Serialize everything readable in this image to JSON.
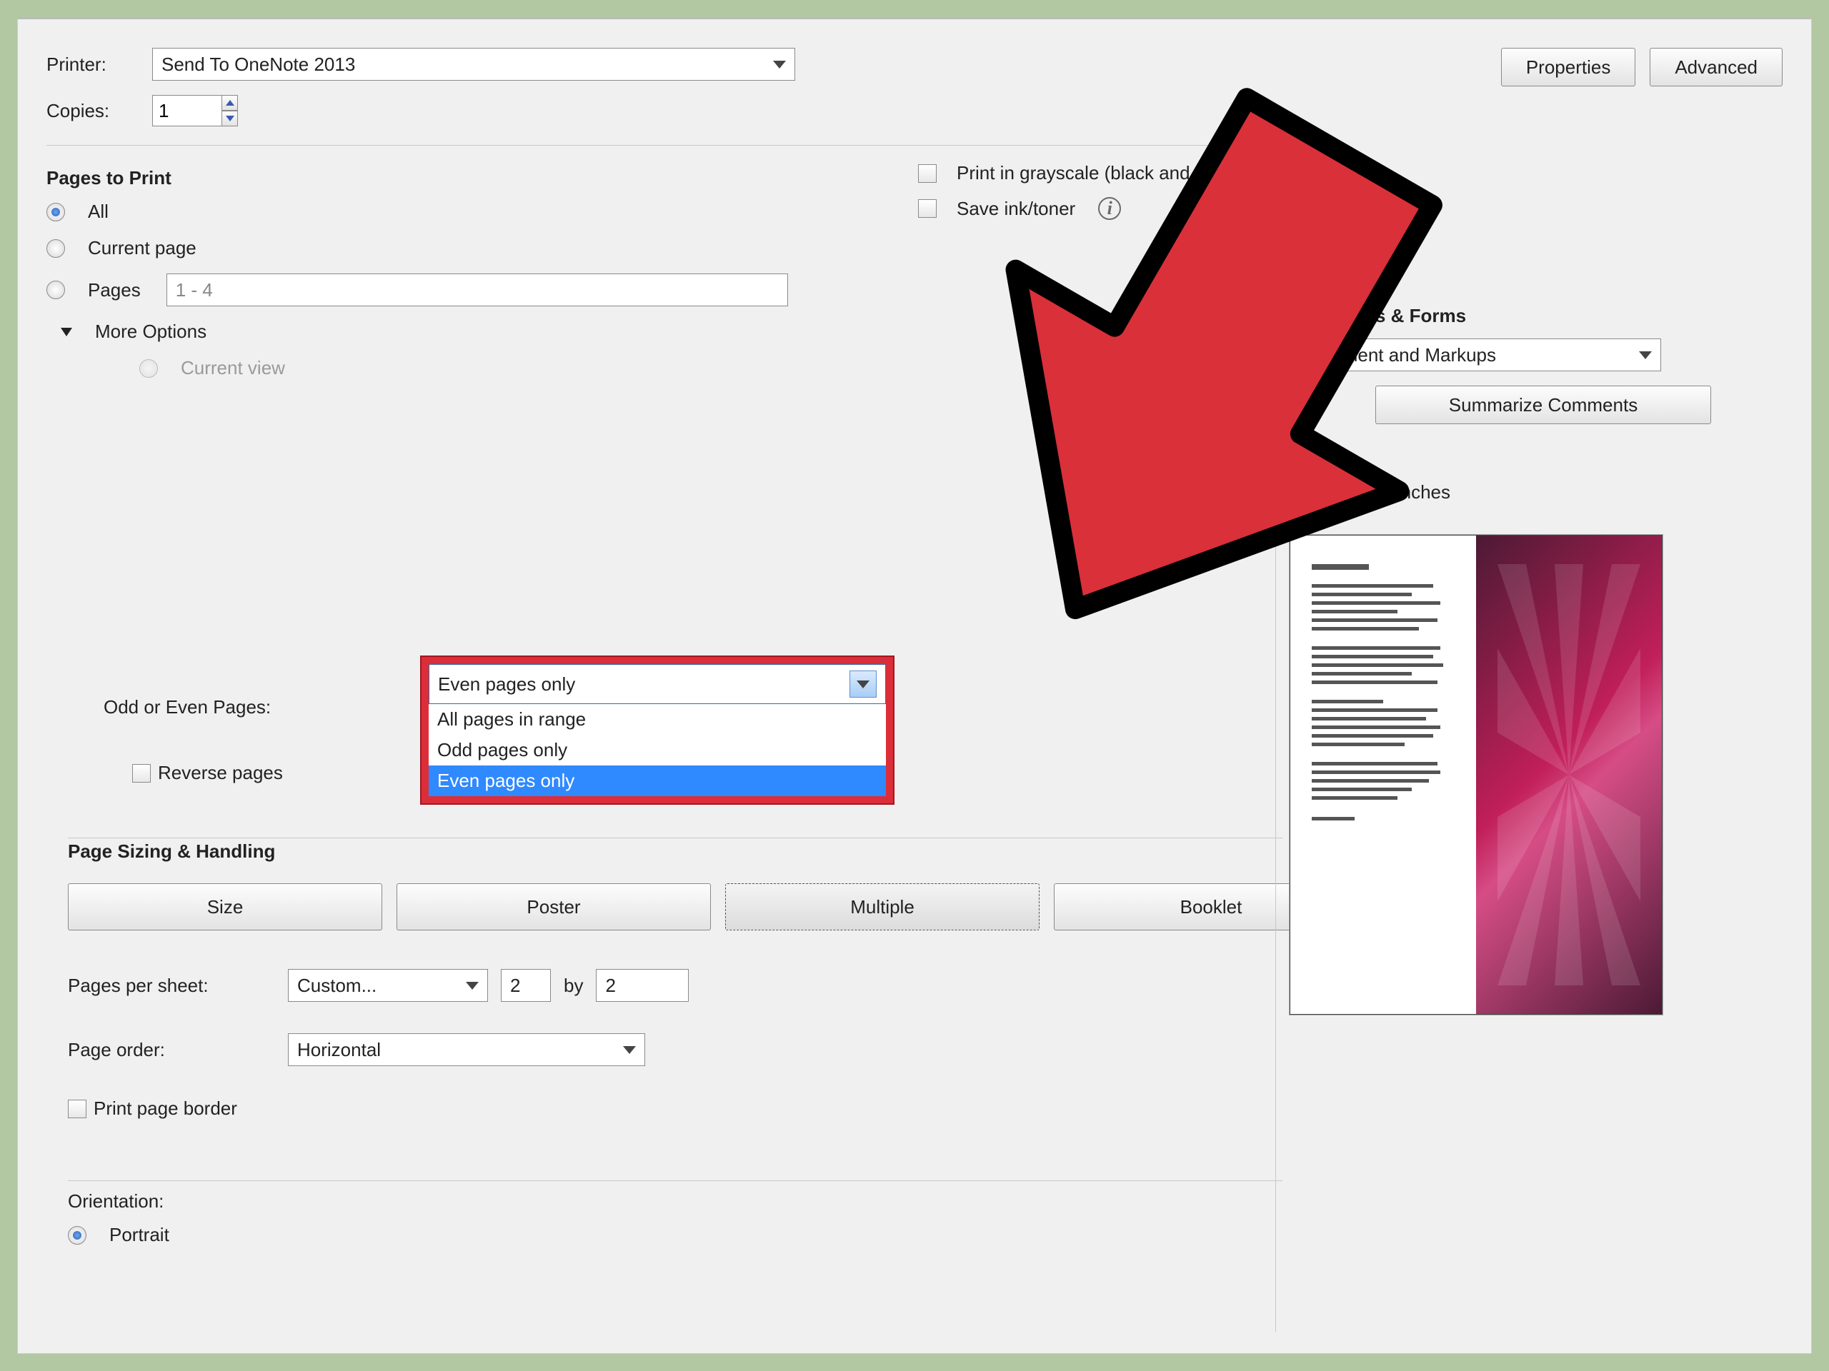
{
  "top": {
    "printer_label": "Printer:",
    "printer_value": "Send To OneNote 2013",
    "copies_label": "Copies:",
    "copies_value": "1",
    "properties_btn": "Properties",
    "advanced_btn": "Advanced",
    "grayscale_label": "Print in grayscale (black and white)",
    "saveink_label": "Save ink/toner"
  },
  "pages": {
    "heading": "Pages to Print",
    "all": "All",
    "current": "Current page",
    "pages_label": "Pages",
    "pages_value": "1 - 4",
    "more": "More Options",
    "current_view": "Current view",
    "odd_even_label": "Odd or Even Pages:",
    "reverse": "Reverse pages"
  },
  "dropdown": {
    "selected": "Even pages only",
    "opt1": "All pages in range",
    "opt2": "Odd pages only",
    "opt3": "Even pages only"
  },
  "sizing": {
    "heading": "Page Sizing & Handling",
    "size": "Size",
    "poster": "Poster",
    "multiple": "Multiple",
    "booklet": "Booklet",
    "pps_label": "Pages per sheet:",
    "pps_value": "Custom...",
    "pps_a": "2",
    "pps_by": "by",
    "pps_b": "2",
    "order_label": "Page order:",
    "order_value": "Horizontal",
    "border": "Print page border"
  },
  "orientation": {
    "heading": "Orientation:",
    "portrait": "Portrait"
  },
  "right": {
    "comments_heading": "Comments & Forms",
    "comments_value": "Document and Markups",
    "summarize_btn": "Summarize Comments",
    "preview_dim": "8.27 x 11.69 Inches"
  }
}
